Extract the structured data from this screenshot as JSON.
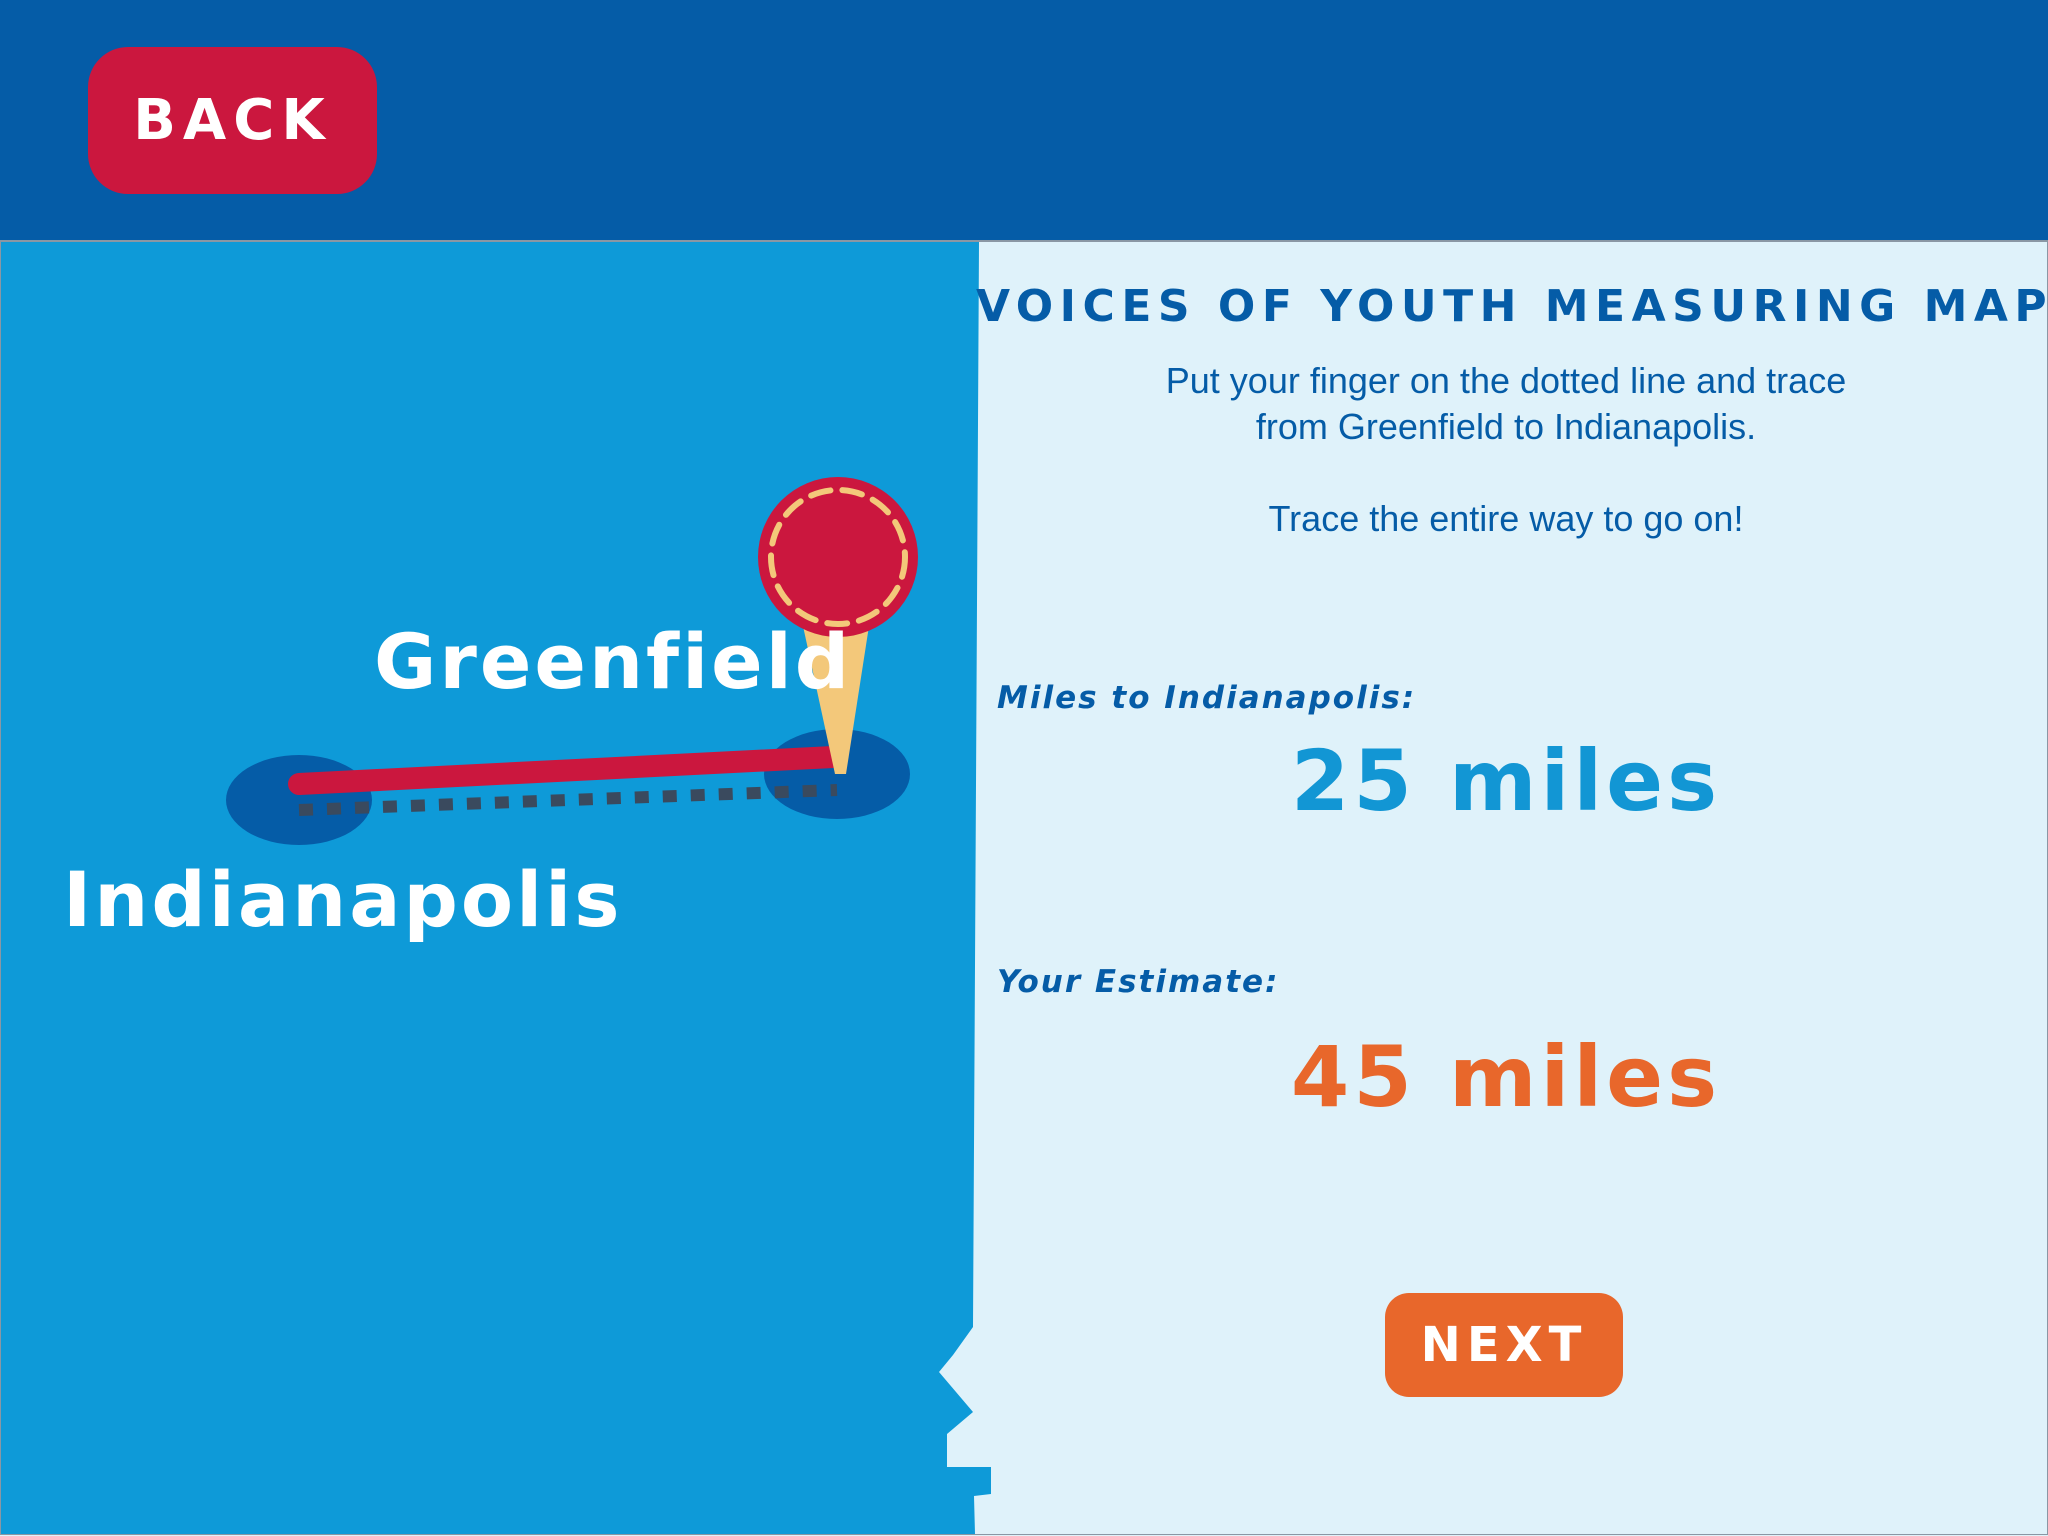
{
  "header": {
    "back_label": "BACK"
  },
  "map": {
    "origin_city": "Greenfield",
    "destination_city": "Indianapolis",
    "colors": {
      "land": "#0e9ad8",
      "city_marker": "#055ca7",
      "trace_line": "#cb173e",
      "dotted_guide": "#3a4a5e",
      "pin_head": "#cb173e",
      "pin_stitch": "#f3c87a",
      "pin_stem": "#f3c87a"
    },
    "trace_progress": 1.0
  },
  "panel": {
    "title": "VOICES OF YOUTH MEASURING MAP",
    "instruction_line1": "Put your finger on the dotted line and trace",
    "instruction_line2": "from Greenfield to Indianapolis.",
    "instruction_line3": "Trace the entire way to go on!",
    "actual_label": "Miles to Indianapolis:",
    "actual_value": "25 miles",
    "estimate_label": "Your Estimate:",
    "estimate_value": "45 miles",
    "colors": {
      "actual": "#1296d4",
      "estimate": "#e8672b"
    }
  },
  "footer": {
    "next_label": "NEXT"
  }
}
